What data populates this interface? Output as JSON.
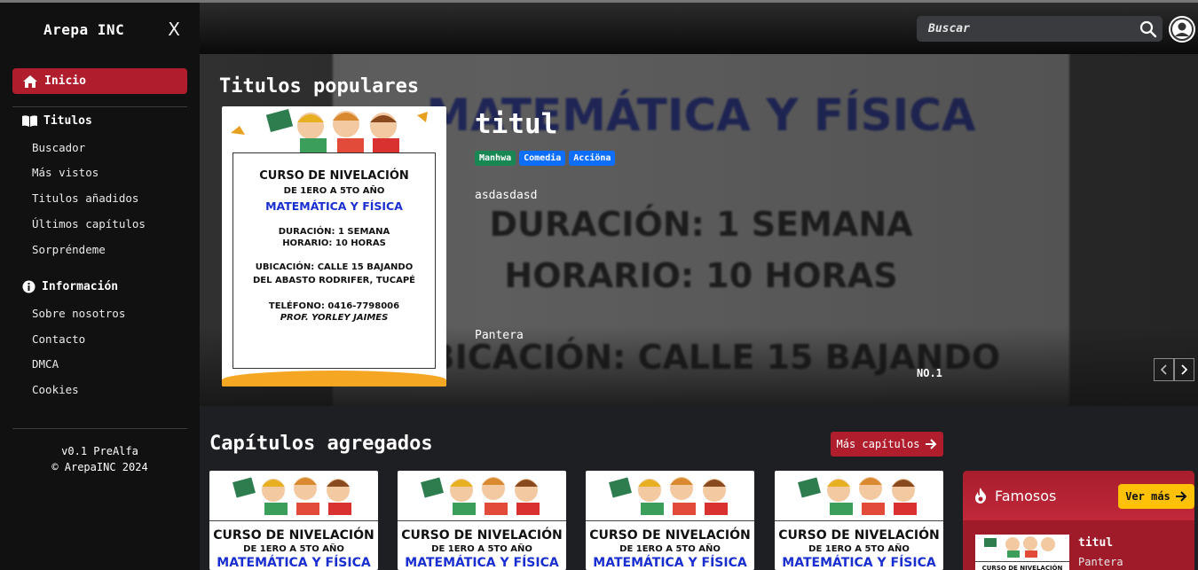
{
  "sidebar": {
    "brand": "Arepa INC",
    "close": "X",
    "active_item": "Inicio",
    "sections": [
      {
        "title": "Titulos",
        "items": [
          "Buscador",
          "Más vistos",
          "Titulos añadidos",
          "Últimos capítulos",
          "Sorpréndeme"
        ]
      },
      {
        "title": "Información",
        "items": [
          "Sobre nosotros",
          "Contacto",
          "DMCA",
          "Cookies"
        ]
      }
    ],
    "version": "v0.1 PreAlfa",
    "copyright": "© ArepaINC 2024"
  },
  "topbar": {
    "search_placeholder": "Buscar"
  },
  "hero": {
    "heading": "Titulos populares",
    "title": "titul",
    "tags": [
      {
        "label": "Manhwa",
        "color": "#198754"
      },
      {
        "label": "Comedia",
        "color": "#0d6efd"
      },
      {
        "label": "Acciöna",
        "color": "#0d6efd"
      }
    ],
    "description": "asdasdasd",
    "author": "Pantera",
    "rank": "NO.1"
  },
  "poster": {
    "line1": "CURSO DE NIVELACIÓN",
    "line2": "DE 1ERO A 5TO AÑO",
    "line3": "MATEMÁTICA Y FÍSICA",
    "line4": "DURACIÓN: 1 SEMANA",
    "line5": "HORARIO: 10 HORAS",
    "line6": "UBICACIÓN: CALLE 15 BAJANDO",
    "line7": "DEL ABASTO RODRIFER, TUCAPÉ",
    "line8": "TELÉFONO: 0416-7798006",
    "line9": "PROF. YORLEY JAIMES"
  },
  "chapters": {
    "heading": "Capítulos agregados",
    "more_label": "Más capítulos"
  },
  "famous": {
    "heading": "Famosos",
    "more_label": "Ver más",
    "items": [
      {
        "title": "titul",
        "author": "Pantera"
      }
    ]
  },
  "colors": {
    "accent": "#b01e2e",
    "yellow": "#ffc107"
  }
}
